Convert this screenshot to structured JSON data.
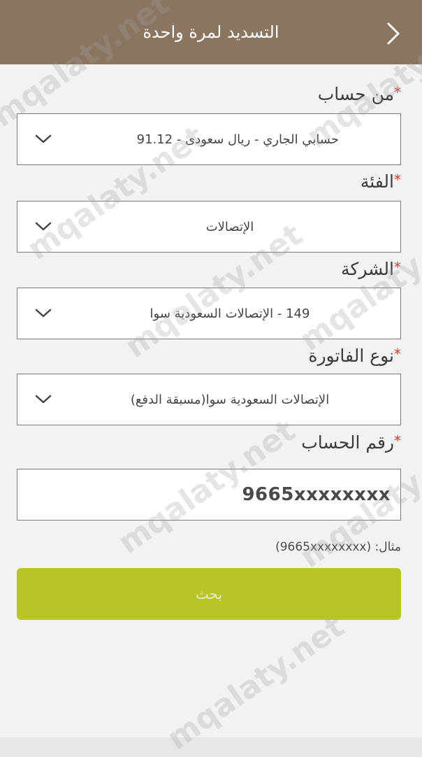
{
  "header": {
    "title": "التسديد لمرة واحدة"
  },
  "form": {
    "required_mark": "*",
    "from_account": {
      "label": "من حساب",
      "value": "حسابي الجاري - ريال سعودى - 91.12"
    },
    "category": {
      "label": "الفئة",
      "value": "الإتصالات"
    },
    "company": {
      "label": "الشركة",
      "value": "149 - الإتصالات السعودية سوا"
    },
    "bill_type": {
      "label": "نوع الفاتورة",
      "value": "الإتصالات السعودية سوا(مسبقة الدفع)"
    },
    "account_number": {
      "label": "رقم الحساب",
      "value": "9665xxxxxxxx",
      "example": "مثال: (9665xxxxxxxx)"
    },
    "search_label": "بحث"
  },
  "watermark": {
    "text": "mqalaty.net"
  },
  "icons": {
    "back": "chevron-right-icon",
    "dropdown": "chevron-down-icon"
  },
  "colors": {
    "header_bg": "#8a7560",
    "button_bg": "#b8c625",
    "required": "#d23a2f"
  }
}
